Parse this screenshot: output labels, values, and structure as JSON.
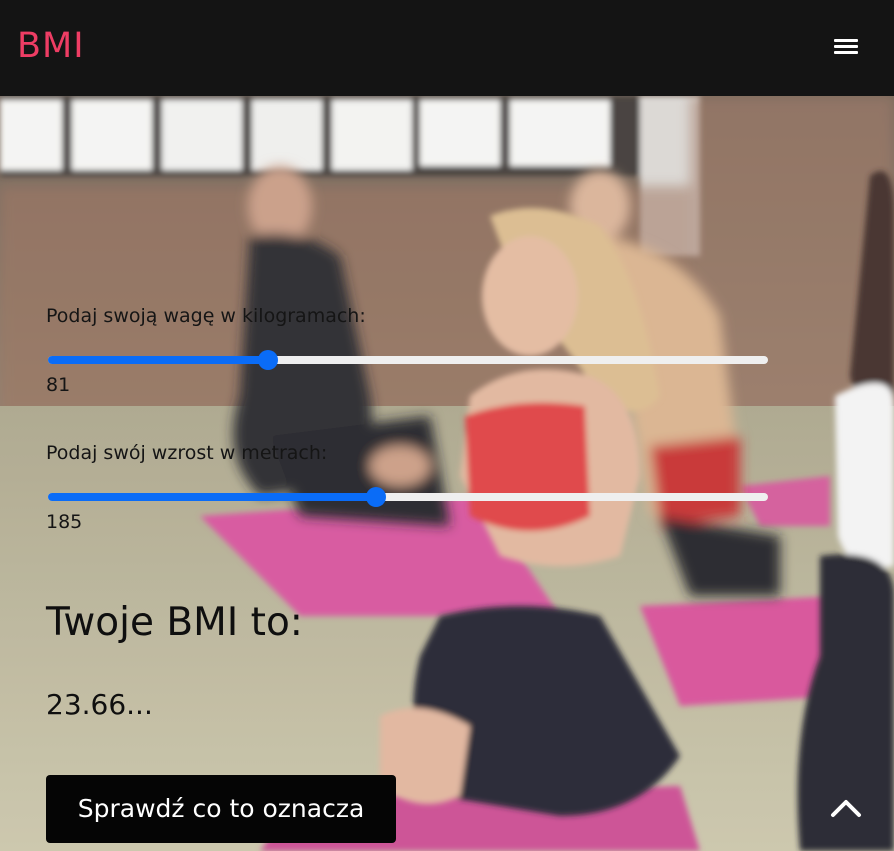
{
  "header": {
    "brand": "BMI",
    "brand_color": "#ee3d64",
    "menu_icon": "hamburger-menu-icon"
  },
  "form": {
    "weight": {
      "label": "Podaj swoją wagę w kilogramach:",
      "value": "81",
      "fill_fraction": 0.305
    },
    "height": {
      "label": "Podaj swój wzrost w metrach:",
      "value": "185",
      "fill_fraction": 0.456
    },
    "slider_color": "#0a6cf7"
  },
  "result": {
    "title": "Twoje BMI to:",
    "value": "23.66..."
  },
  "cta": {
    "label": "Sprawdź co to oznacza"
  },
  "scroll_top_icon": "chevron-up-icon"
}
